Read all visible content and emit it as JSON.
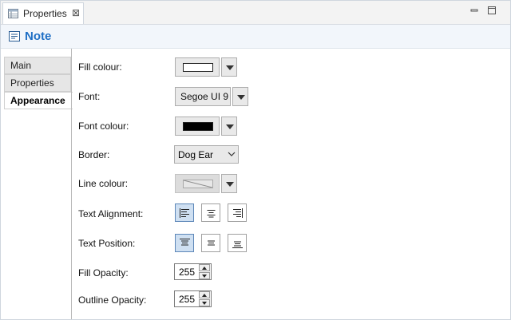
{
  "tab": {
    "title": "Properties",
    "close_glyph": "⊠"
  },
  "header": {
    "title": "Note",
    "icon": "note-icon"
  },
  "left_tabs": [
    {
      "label": "Main",
      "selected": false
    },
    {
      "label": "Properties",
      "selected": false
    },
    {
      "label": "Appearance",
      "selected": true
    }
  ],
  "fields": {
    "fill_colour": {
      "label": "Fill colour:",
      "value": "#ffffff"
    },
    "font": {
      "label": "Font:",
      "value": "Segoe UI 9"
    },
    "font_colour": {
      "label": "Font colour:",
      "value": "#000000"
    },
    "border": {
      "label": "Border:",
      "value": "Dog Ear"
    },
    "line_colour": {
      "label": "Line colour:",
      "disabled": true
    },
    "text_alignment": {
      "label": "Text Alignment:",
      "options": [
        "align-left-icon",
        "align-center-icon",
        "align-right-icon"
      ],
      "selected": "align-left-icon"
    },
    "text_position": {
      "label": "Text Position:",
      "options": [
        "align-top-icon",
        "align-middle-icon",
        "align-bottom-icon"
      ],
      "selected": "align-top-icon"
    },
    "fill_opacity": {
      "label": "Fill Opacity:",
      "value": "255"
    },
    "outline_opacity": {
      "label": "Outline Opacity:",
      "value": "255"
    }
  },
  "colors": {
    "accent": "#1f6fc5",
    "selected_toggle": "#cfe0f2"
  }
}
